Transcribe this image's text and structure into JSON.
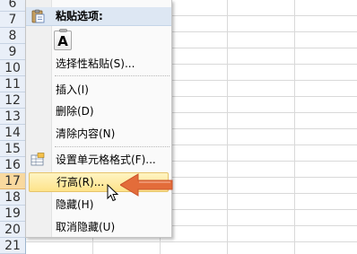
{
  "spreadsheet": {
    "row_numbers": [
      "6",
      "7",
      "8",
      "9",
      "10",
      "11",
      "12",
      "13",
      "14",
      "15",
      "16",
      "17",
      "18",
      "19",
      "20",
      "21"
    ],
    "selected_row": "17"
  },
  "context_menu": {
    "paste_options_label": "粘贴选项:",
    "paste_option_letter": "A",
    "items": [
      {
        "label": "选择性粘贴(S)..."
      },
      {
        "label": "插入(I)"
      },
      {
        "label": "删除(D)"
      },
      {
        "label": "清除内容(N)"
      },
      {
        "label": "设置单元格格式(F)..."
      },
      {
        "label": "行高(R)..."
      },
      {
        "label": "隐藏(H)"
      },
      {
        "label": "取消隐藏(U)"
      }
    ],
    "highlighted_item": "行高(R)..."
  },
  "icons": {
    "clipboard": "clipboard-icon",
    "paste_values": "paste-text-icon",
    "format_cells": "format-cells-icon",
    "arrow": "red-arrow-icon",
    "cursor": "mouse-pointer-icon"
  },
  "colors": {
    "arrow": "#e36c3a",
    "hover_fill": "#fde38a",
    "row_header_bg": "#e9eff8",
    "gridline": "#d9d9d9"
  }
}
